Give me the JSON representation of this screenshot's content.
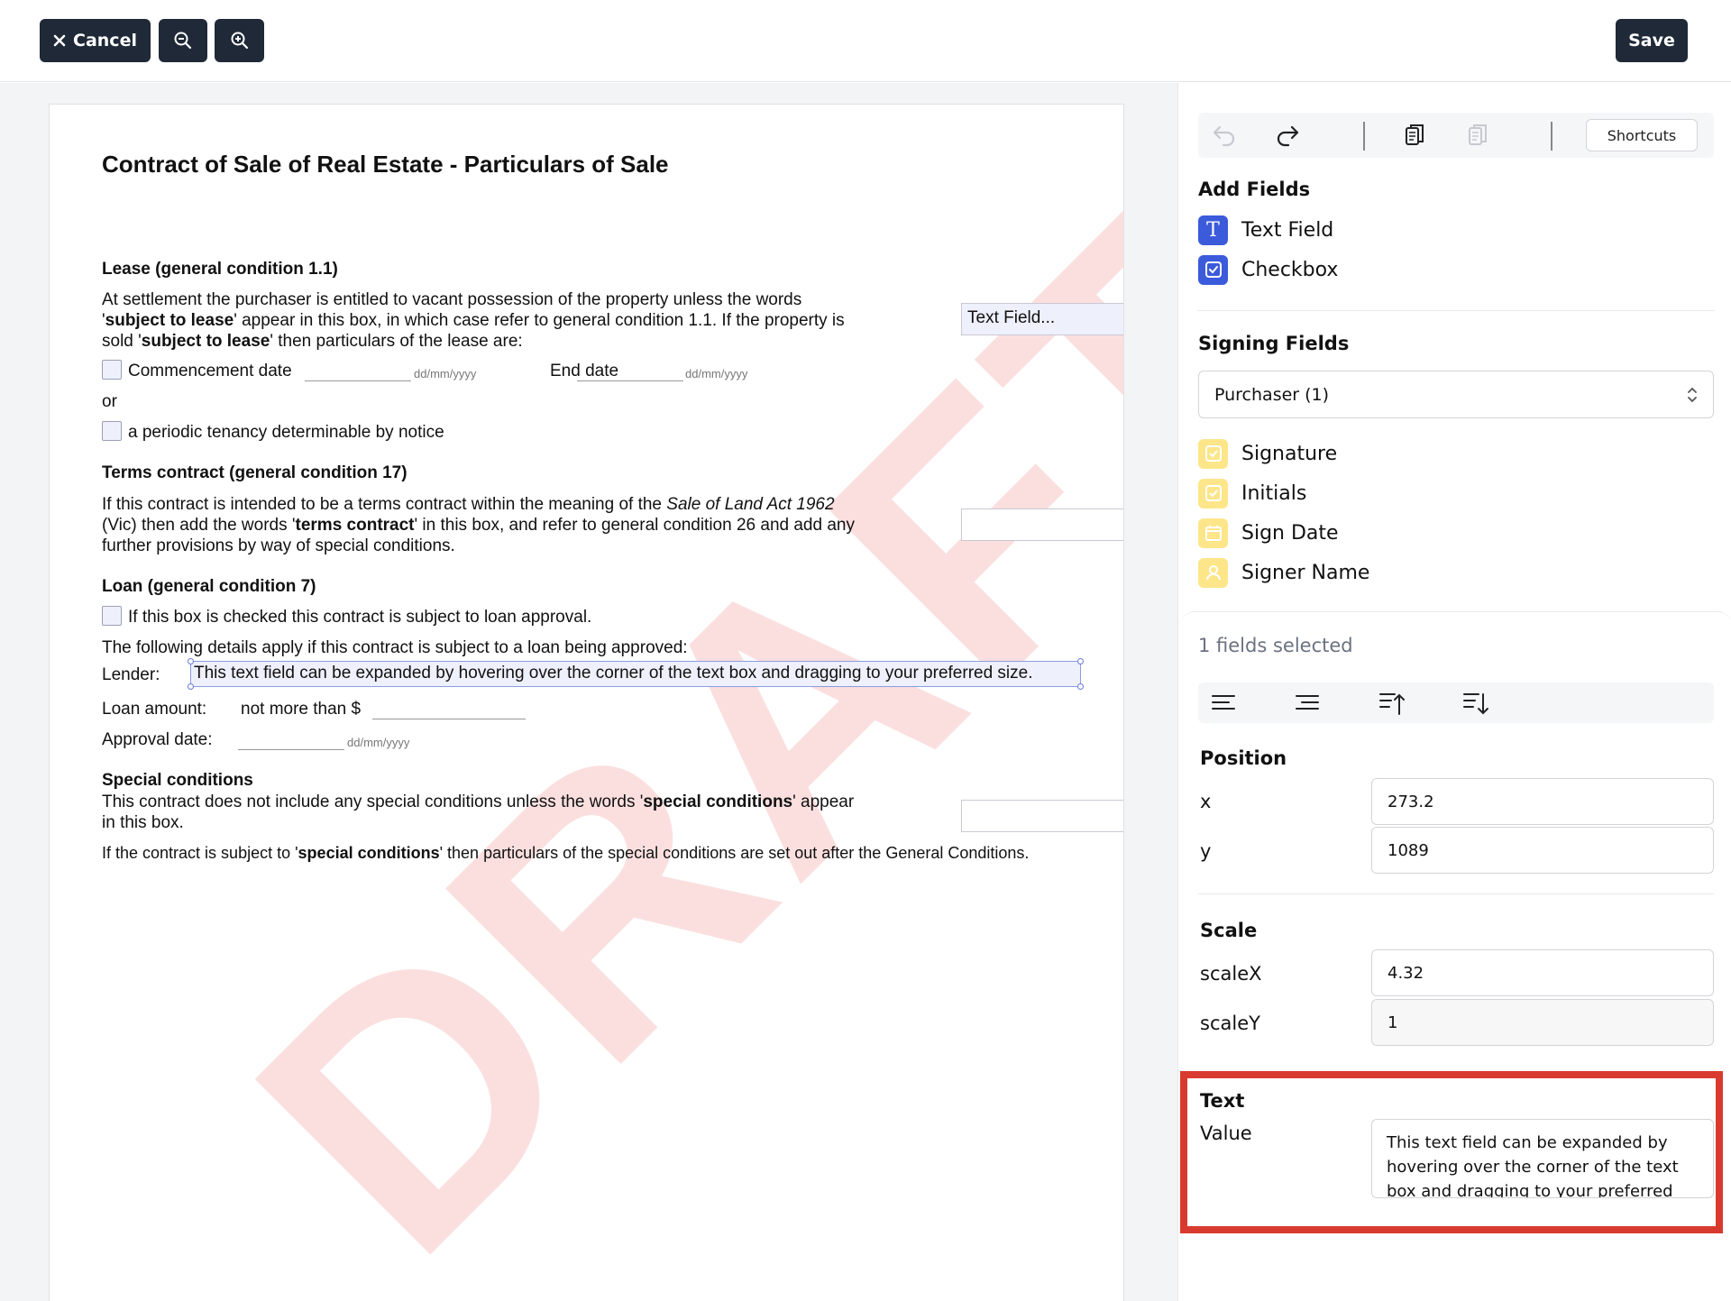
{
  "toolbar": {
    "cancel_label": "Cancel",
    "save_label": "Save",
    "icons": [
      "close-icon",
      "zoom-out-icon",
      "zoom-in-icon"
    ]
  },
  "document": {
    "title": "Contract of Sale of Real Estate - Particulars of Sale",
    "watermark": "DRAFT",
    "lease": {
      "heading": "Lease (general condition 1.1)",
      "para_1a": "At settlement the purchaser is entitled to vacant possession of the property unless the words",
      "para_2a": "'",
      "para_2b": "subject to lease",
      "para_2c": "' appear in this box, in which case refer to general condition 1.1. If the property is",
      "para_3a": "sold '",
      "para_3b": "subject to lease",
      "para_3c": "' then particulars of the lease are:",
      "field_value": "Text Field...",
      "commencement_label": "Commencement date",
      "date_format": "dd/mm/yyyy",
      "end_label": "End date",
      "or_text": "or",
      "periodic_label": "a periodic tenancy determinable by notice"
    },
    "terms": {
      "heading": "Terms contract (general condition 17)",
      "line1a": "If this contract is intended to be a terms contract within the meaning of the ",
      "line1b": "Sale of Land Act 1962",
      "line2a": "(Vic) then add the words '",
      "line2b": "terms contract",
      "line2c": "' in this box, and refer to general condition 26 and add any",
      "line3": "further provisions by way of special conditions."
    },
    "loan": {
      "heading": "Loan (general condition 7)",
      "checkbox_label": "If this box is checked this contract is subject to loan approval.",
      "details_intro": "The following details apply if this contract is subject to a loan being approved:",
      "lender_label": "Lender:",
      "lender_value": "This text field can be expanded by hovering over the corner of the text box and dragging to your preferred size.",
      "amount_label": "Loan amount:",
      "amount_prefix": "not more than $",
      "approval_label": "Approval date:",
      "date_format": "dd/mm/yyyy"
    },
    "special": {
      "heading": "Special conditions",
      "line1a": "This contract does not include any special conditions unless the words '",
      "line1b": "special conditions",
      "line1c": "' appear",
      "line2": "in this box.",
      "line3a": "If the contract is subject to '",
      "line3b": "special conditions",
      "line3c": "' then particulars of the special conditions are set out after the General Conditions."
    }
  },
  "panel": {
    "history_icons": [
      "undo-icon",
      "redo-icon",
      "copy-icon",
      "paste-icon"
    ],
    "shortcuts_label": "Shortcuts",
    "add_fields": {
      "title": "Add Fields",
      "items": [
        {
          "label": "Text Field",
          "icon": "text-field-icon",
          "glyph": "T"
        },
        {
          "label": "Checkbox",
          "icon": "checkbox-icon"
        }
      ]
    },
    "signing_fields": {
      "title": "Signing Fields",
      "selected_signer": "Purchaser (1)",
      "items": [
        {
          "label": "Signature",
          "icon": "signature-icon"
        },
        {
          "label": "Initials",
          "icon": "initials-icon"
        },
        {
          "label": "Sign Date",
          "icon": "calendar-icon"
        },
        {
          "label": "Signer Name",
          "icon": "user-icon"
        }
      ]
    },
    "selection_count": "1 fields selected",
    "align_icons": [
      "align-left-icon",
      "align-right-icon",
      "align-top-icon",
      "align-bottom-icon"
    ],
    "position": {
      "title": "Position",
      "x_label": "x",
      "x_value": "273.2",
      "y_label": "y",
      "y_value": "1089"
    },
    "scale": {
      "title": "Scale",
      "x_label": "scaleX",
      "x_value": "4.32",
      "y_label": "scaleY",
      "y_value": "1"
    },
    "text": {
      "title": "Text",
      "value_label": "Value",
      "value": "This text field can be expanded by hovering over the corner of the text box and dragging to your preferred size."
    },
    "colors": {
      "accent_blue": "#3b5bdb",
      "signing_yellow": "#fde68a",
      "highlight_red": "#d93a2f",
      "button_dark": "#1f2937"
    }
  }
}
